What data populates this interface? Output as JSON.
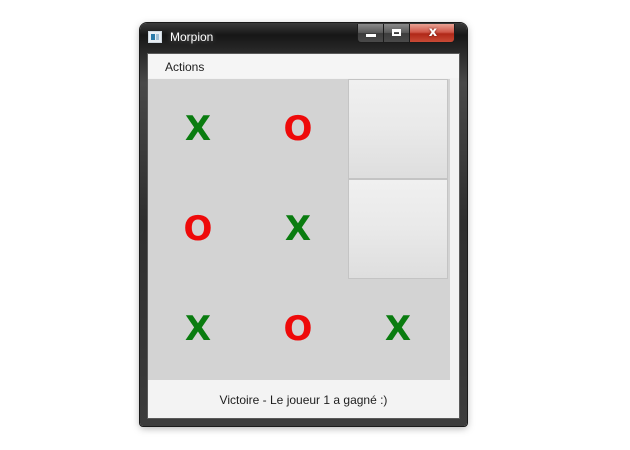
{
  "window": {
    "title": "Morpion",
    "close_glyph": "x",
    "icon": "app-window-icon"
  },
  "menu": {
    "items": [
      {
        "label": "Actions"
      }
    ]
  },
  "board": {
    "cells": [
      [
        "X",
        "O",
        ""
      ],
      [
        "O",
        "X",
        ""
      ],
      [
        "X",
        "O",
        "X"
      ]
    ],
    "colors": {
      "X": "#0a7c10",
      "O": "#ee0a0a"
    }
  },
  "status": {
    "text": "Victoire - Le joueur 1 a gagné :)"
  }
}
